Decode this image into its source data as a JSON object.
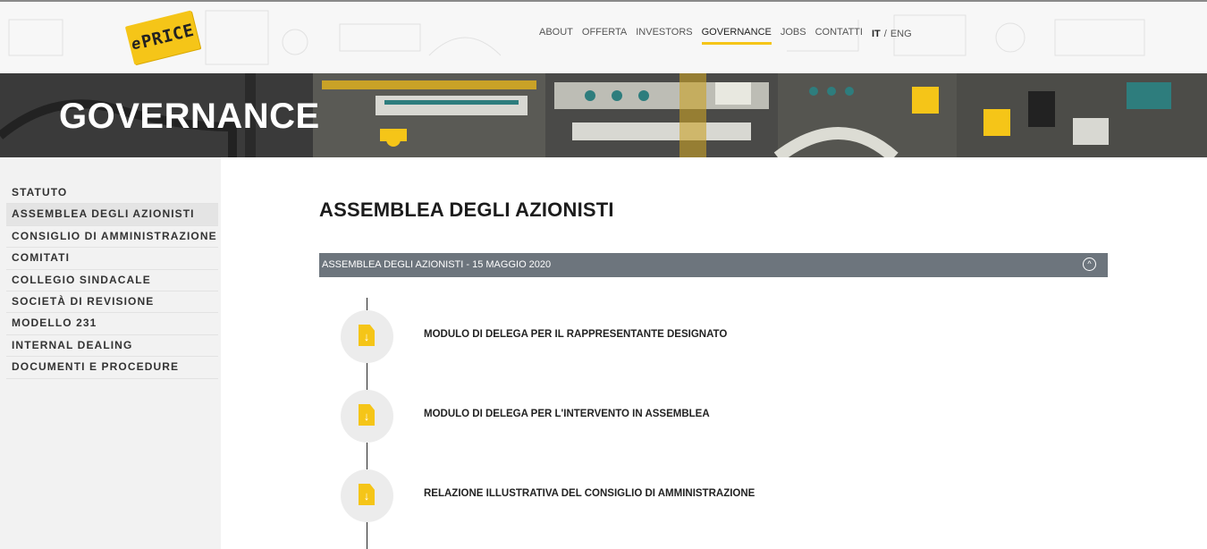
{
  "logo": {
    "prefix": "e",
    "text": "PRICE"
  },
  "nav": {
    "items": [
      "ABOUT",
      "OFFERTA",
      "INVESTORS",
      "GOVERNANCE",
      "JOBS",
      "CONTATTI"
    ],
    "active": "GOVERNANCE",
    "lang_it": "IT",
    "lang_sep": "/",
    "lang_eng": "ENG"
  },
  "hero": {
    "title": "GOVERNANCE"
  },
  "sidebar": {
    "items": [
      {
        "label": "STATUTO"
      },
      {
        "label": "ASSEMBLEA DEGLI AZIONISTI",
        "active": true
      },
      {
        "label": "CONSIGLIO DI AMMINISTRAZIONE"
      },
      {
        "label": "COMITATI"
      },
      {
        "label": "COLLEGIO SINDACALE"
      },
      {
        "label": "SOCIETÀ DI REVISIONE"
      },
      {
        "label": "MODELLO 231"
      },
      {
        "label": "INTERNAL DEALING"
      },
      {
        "label": "DOCUMENTI E PROCEDURE"
      }
    ]
  },
  "main": {
    "title": "ASSEMBLEA DEGLI AZIONISTI",
    "accordion": {
      "header": "ASSEMBLEA DEGLI AZIONISTI - 15 MAGGIO 2020",
      "toggle_icon": "chevron-up-circle-icon",
      "documents": [
        {
          "label": "MODULO DI DELEGA PER IL RAPPRESENTANTE DESIGNATO",
          "icon": "file-download-icon"
        },
        {
          "label": "MODULO DI DELEGA PER L'INTERVENTO IN ASSEMBLEA",
          "icon": "file-download-icon"
        },
        {
          "label": "RELAZIONE ILLUSTRATIVA DEL CONSIGLIO DI AMMINISTRAZIONE",
          "icon": "file-download-icon"
        }
      ]
    }
  },
  "colors": {
    "accent": "#f5c518",
    "accordion_bg": "#6d757d",
    "sidebar_bg": "#f2f2f2",
    "hero_bg": "#3c3c3c"
  }
}
